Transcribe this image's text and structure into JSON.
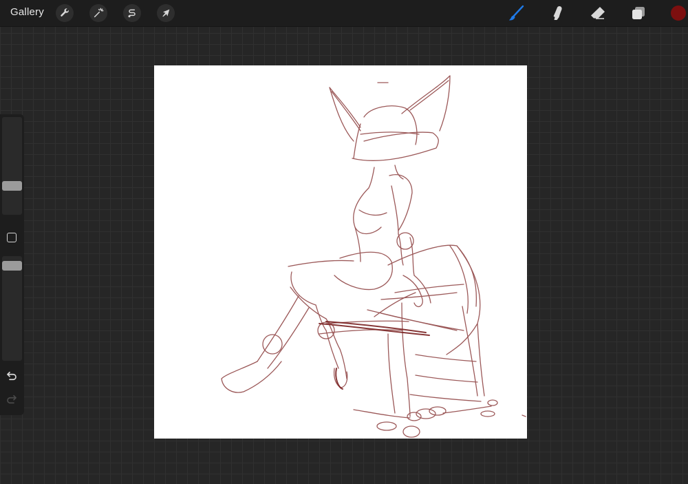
{
  "topbar": {
    "gallery_label": "Gallery",
    "left_tools": [
      {
        "name": "actions",
        "icon": "wrench-icon"
      },
      {
        "name": "adjustments",
        "icon": "magic-wand-icon"
      },
      {
        "name": "selection",
        "icon": "selection-s-icon"
      },
      {
        "name": "transform",
        "icon": "arrow-cursor-icon"
      }
    ],
    "right_tools": [
      {
        "name": "brush",
        "icon": "brush-icon",
        "active": true
      },
      {
        "name": "smudge",
        "icon": "smudge-finger-icon",
        "active": false
      },
      {
        "name": "eraser",
        "icon": "eraser-icon",
        "active": false
      },
      {
        "name": "layers",
        "icon": "layers-icon",
        "active": false
      }
    ],
    "current_color": "#7d0f0f"
  },
  "sidebar": {
    "brush_size_level": 0.27,
    "opacity_level": 0.95,
    "modify_icon": "square-icon",
    "undo_icon": "undo-icon",
    "redo_icon": "redo-icon",
    "redo_enabled": false
  },
  "canvas": {
    "background": "#ffffff",
    "sketch_color": "#8a3b3b",
    "active_tool_color": "#1f7ae8"
  }
}
